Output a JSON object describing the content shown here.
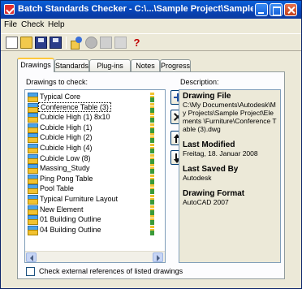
{
  "window": {
    "title": "Batch Standards Checker - C:\\...\\Sample Project\\Sample P..."
  },
  "menu": [
    "File",
    "Check",
    "Help"
  ],
  "toolbar": {
    "icons": [
      "new-file-icon",
      "open-folder-icon",
      "save-icon",
      "save-as-icon",
      "check-icon",
      "stop-icon",
      "copy-icon",
      "report-icon",
      "help-icon"
    ],
    "help_label": "?"
  },
  "tabs": [
    {
      "label": "Drawings",
      "active": true
    },
    {
      "label": "Standards",
      "active": false
    },
    {
      "label": "Plug-ins",
      "active": false
    },
    {
      "label": "Notes",
      "active": false
    },
    {
      "label": "Progress",
      "active": false
    }
  ],
  "drawings_panel": {
    "label": "Drawings to check:",
    "items": [
      {
        "label": "Typical Core",
        "selected": false
      },
      {
        "label": "Conference Table (3)",
        "selected": true
      },
      {
        "label": "Cubicle High (1) 8x10",
        "selected": false
      },
      {
        "label": "Cubicle High (1)",
        "selected": false
      },
      {
        "label": "Cubicle High (2)",
        "selected": false
      },
      {
        "label": "Cubicle High (4)",
        "selected": false
      },
      {
        "label": "Cubicle Low (8)",
        "selected": false
      },
      {
        "label": "Massing_Study",
        "selected": false
      },
      {
        "label": "Ping Pong Table",
        "selected": false
      },
      {
        "label": "Pool Table",
        "selected": false
      },
      {
        "label": "Typical Furniture Layout",
        "selected": false
      },
      {
        "label": "New Element",
        "selected": false
      },
      {
        "label": "01 Building Outline",
        "selected": false
      },
      {
        "label": "04 Building Outline",
        "selected": false
      }
    ]
  },
  "description": {
    "label": "Description:",
    "drawing_file_heading": "Drawing File",
    "drawing_file_value": "C:\\My Documents\\Autodesk\\My Projects\\Sample Project\\Elements \\Furniture\\Conference Table (3).dwg",
    "last_modified_heading": "Last Modified",
    "last_modified_value": "Freitag, 18. Januar 2008",
    "last_saved_heading": "Last Saved By",
    "last_saved_value": "Autodesk",
    "format_heading": "Drawing Format",
    "format_value": "AutoCAD 2007"
  },
  "check_external": {
    "label": "Check external references of listed drawings",
    "checked": false
  }
}
